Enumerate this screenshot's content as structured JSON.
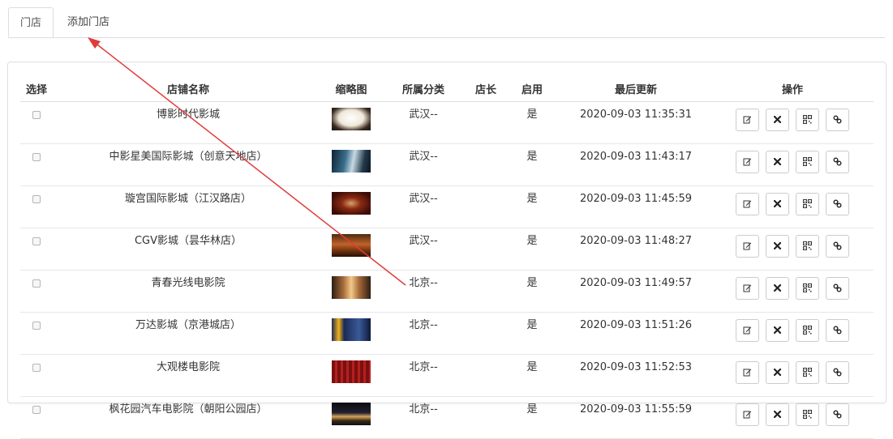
{
  "tabs": [
    {
      "label": "门店",
      "active": true
    },
    {
      "label": "添加门店",
      "active": false
    }
  ],
  "table": {
    "headers": [
      "选择",
      "店铺名称",
      "缩略图",
      "所属分类",
      "店长",
      "启用",
      "最后更新",
      "操作"
    ],
    "rows": [
      {
        "name": "博影时代影城",
        "thumb": "screen-white",
        "category": "武汉--",
        "manager": "",
        "enabled": "是",
        "updated": "2020-09-03 11:35:31"
      },
      {
        "name": "中影星美国际影城（创意天地店）",
        "thumb": "lobby-blue",
        "category": "武汉--",
        "manager": "",
        "enabled": "是",
        "updated": "2020-09-03 11:43:17"
      },
      {
        "name": "璇宫国际影城（江汉路店）",
        "thumb": "hall-red",
        "category": "武汉--",
        "manager": "",
        "enabled": "是",
        "updated": "2020-09-03 11:45:59"
      },
      {
        "name": "CGV影城（昙华林店）",
        "thumb": "lobby-orange",
        "category": "武汉--",
        "manager": "",
        "enabled": "是",
        "updated": "2020-09-03 11:48:27"
      },
      {
        "name": "青春光线电影院",
        "thumb": "corridor-warm",
        "category": "北京--",
        "manager": "",
        "enabled": "是",
        "updated": "2020-09-03 11:49:57"
      },
      {
        "name": "万达影城（京港城店）",
        "thumb": "sign-4d",
        "category": "北京--",
        "manager": "",
        "enabled": "是",
        "updated": "2020-09-03 11:51:26"
      },
      {
        "name": "大观楼电影院",
        "thumb": "seats-red",
        "category": "北京--",
        "manager": "",
        "enabled": "是",
        "updated": "2020-09-03 11:52:53"
      },
      {
        "name": "枫花园汽车电影院（朝阳公园店）",
        "thumb": "night-outdoor",
        "category": "北京--",
        "manager": "",
        "enabled": "是",
        "updated": "2020-09-03 11:55:59"
      }
    ],
    "actions": [
      "edit-icon",
      "delete-icon",
      "qrcode-icon",
      "link-icon"
    ]
  },
  "colors": {
    "annotation_arrow": "#e03c3c"
  }
}
